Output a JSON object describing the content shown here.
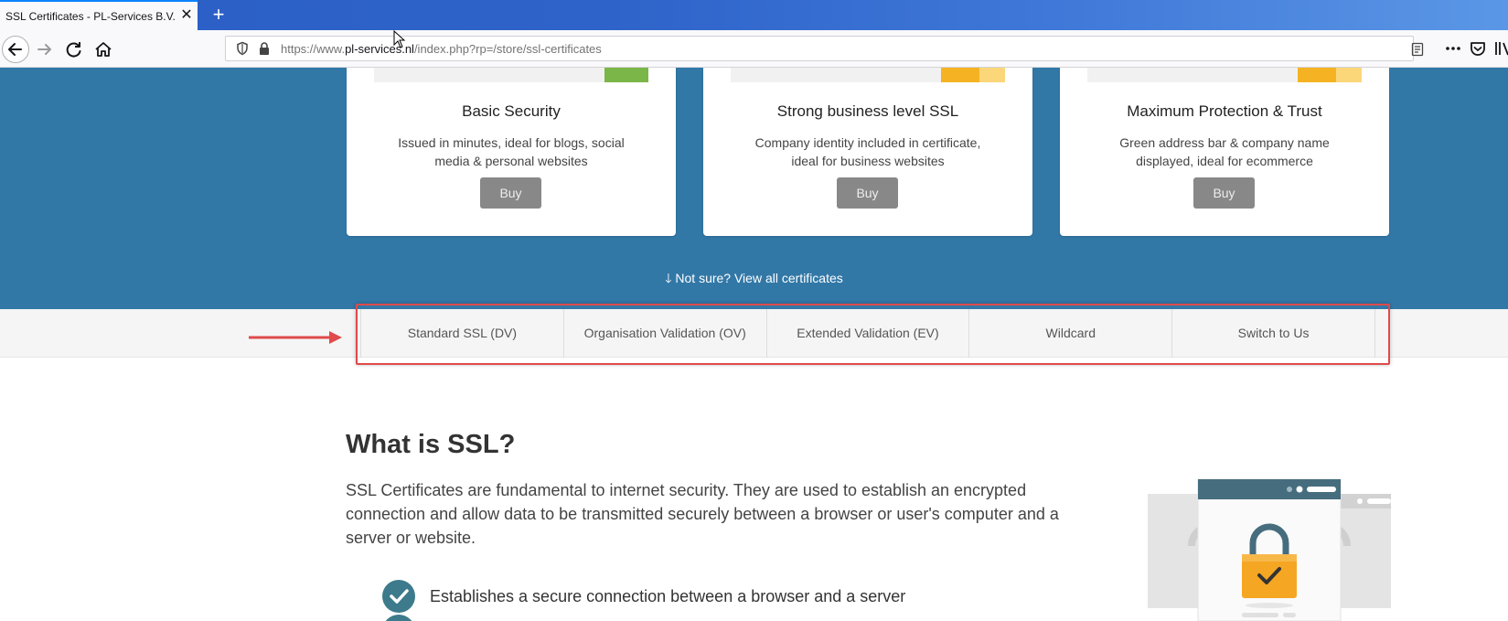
{
  "browser": {
    "tab_title": "SSL Certificates - PL-Services B.V.",
    "tab_close": "✕",
    "new_tab": "+",
    "url_prefix": "https://www.",
    "url_domain": "pl-services.nl",
    "url_path": "/index.php?rp=/store/ssl-certificates"
  },
  "hero": {
    "cards": [
      {
        "title": "Basic Security",
        "description": "Issued in minutes, ideal for blogs, social media & personal websites",
        "button": "Buy",
        "accent": "#7ab648"
      },
      {
        "title": "Strong business level SSL",
        "description": "Company identity included in certificate, ideal for business websites",
        "button": "Buy",
        "accent": "#f5b323"
      },
      {
        "title": "Maximum Protection & Trust",
        "description": "Green address bar & company name displayed, ideal for ecommerce",
        "button": "Buy",
        "accent": "#f5b323"
      }
    ],
    "not_sure_link": "Not sure? View all certificates",
    "background": "#3278a7"
  },
  "category_tabs": [
    {
      "label": "Standard SSL (DV)"
    },
    {
      "label": "Organisation Validation (OV)"
    },
    {
      "label": "Extended Validation (EV)"
    },
    {
      "label": "Wildcard"
    },
    {
      "label": "Switch to Us"
    }
  ],
  "content": {
    "heading": "What is SSL?",
    "paragraph": "SSL Certificates are fundamental to internet security. They are used to establish an encrypted connection and allow data to be transmitted securely between a browser or user's computer and a server or website.",
    "features": [
      "Establishes a secure connection between a browser and a server"
    ]
  },
  "annotation": {
    "highlight_color": "#e04a4a"
  }
}
